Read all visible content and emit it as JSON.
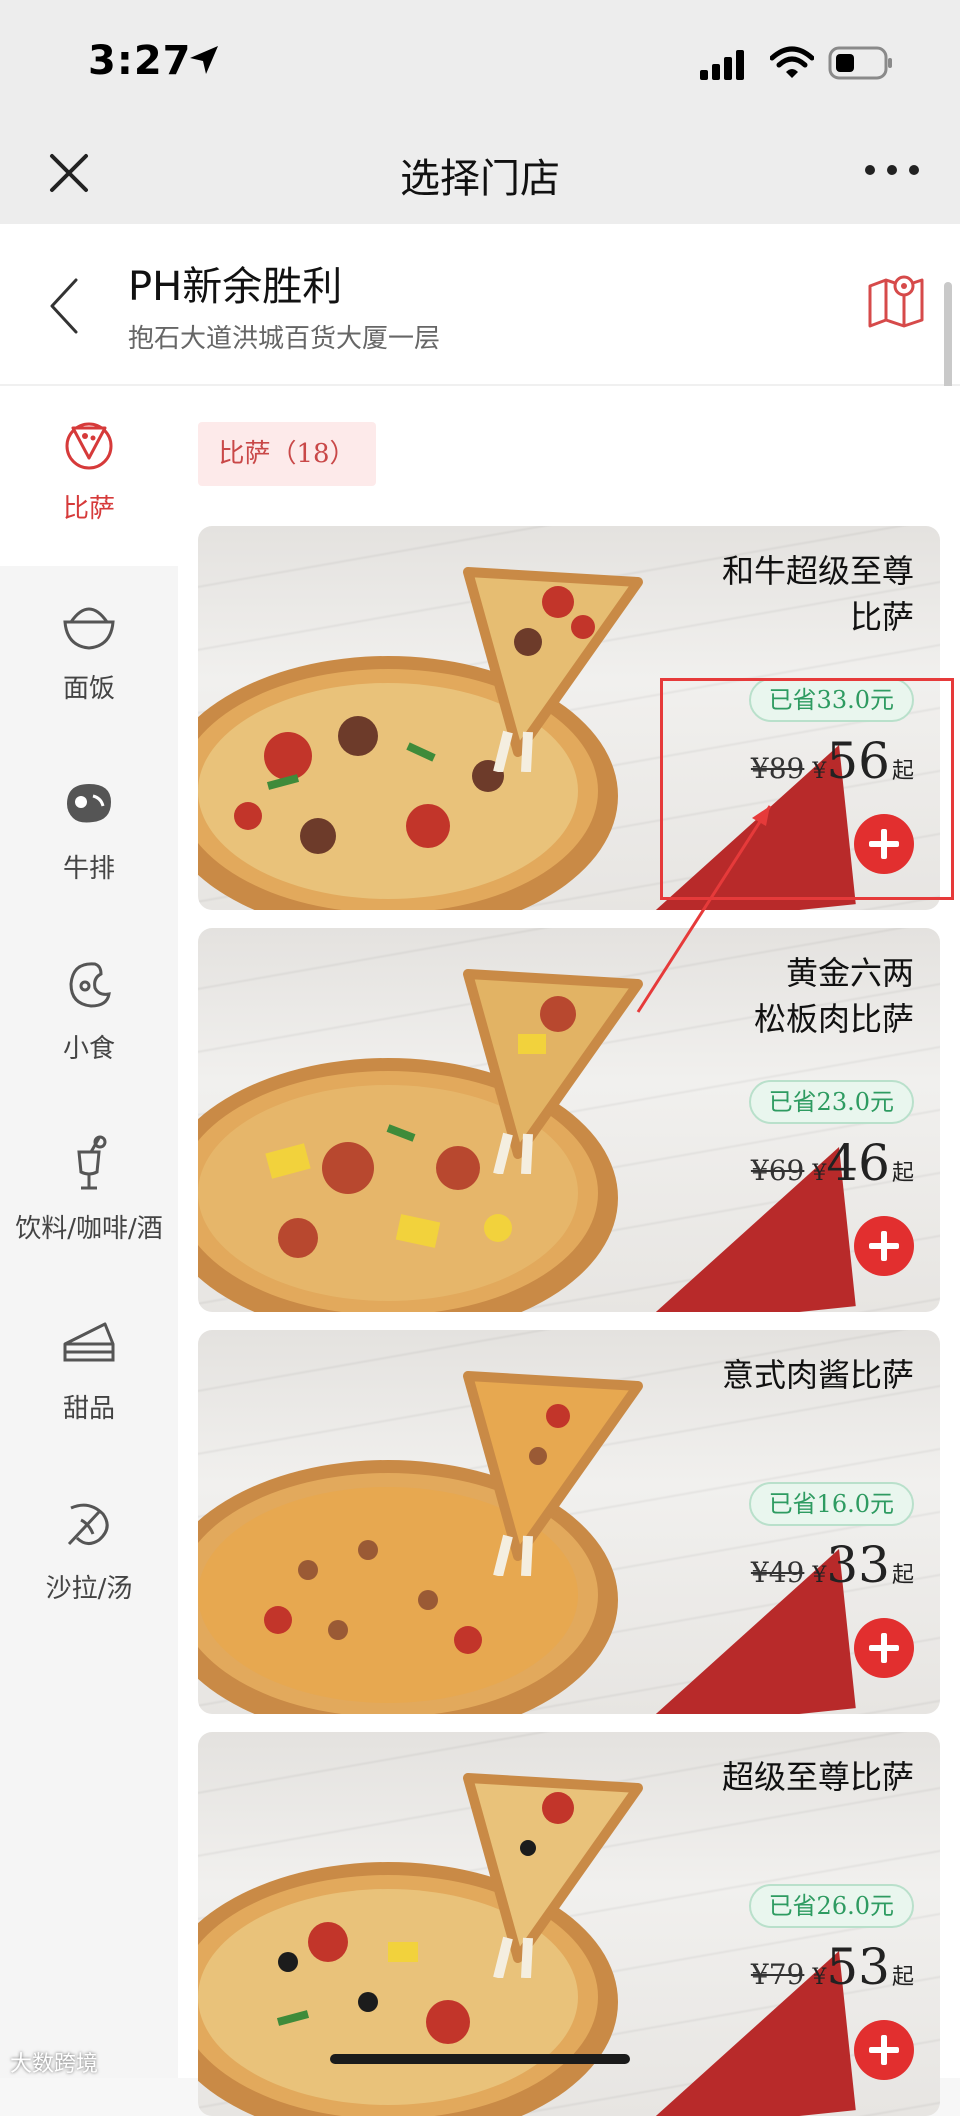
{
  "status_bar": {
    "time": "3:27"
  },
  "nav": {
    "title": "选择门店"
  },
  "store": {
    "name": "PH新余胜利",
    "address": "抱石大道洪城百货大厦一层"
  },
  "sidebar": {
    "items": [
      {
        "label": "比萨",
        "icon": "pizza-icon",
        "active": true
      },
      {
        "label": "面饭",
        "icon": "bowl-icon",
        "active": false
      },
      {
        "label": "牛排",
        "icon": "steak-icon",
        "active": false
      },
      {
        "label": "小食",
        "icon": "snack-icon",
        "active": false
      },
      {
        "label": "饮料/咖啡/酒",
        "icon": "drink-icon",
        "active": false
      },
      {
        "label": "甜品",
        "icon": "cake-icon",
        "active": false
      },
      {
        "label": "沙拉/汤",
        "icon": "salad-icon",
        "active": false
      }
    ]
  },
  "category": {
    "label": "比萨（18）"
  },
  "products": [
    {
      "name": "和牛超级至尊\n比萨",
      "saving": "已省33.0元",
      "original": "¥89",
      "currency": "¥",
      "price": "56",
      "suffix": "起"
    },
    {
      "name": "黄金六两\n松板肉比萨",
      "saving": "已省23.0元",
      "original": "¥69",
      "currency": "¥",
      "price": "46",
      "suffix": "起"
    },
    {
      "name": "意式肉酱比萨",
      "saving": "已省16.0元",
      "original": "¥49",
      "currency": "¥",
      "price": "33",
      "suffix": "起"
    },
    {
      "name": "超级至尊比萨",
      "saving": "已省26.0元",
      "original": "¥79",
      "currency": "¥",
      "price": "53",
      "suffix": "起"
    }
  ],
  "watermark": "大数跨境",
  "colors": {
    "accent": "#e22f2f",
    "active_text": "#d63a3a",
    "saving_green": "#2e9b61",
    "annotation": "#e63a3a"
  }
}
